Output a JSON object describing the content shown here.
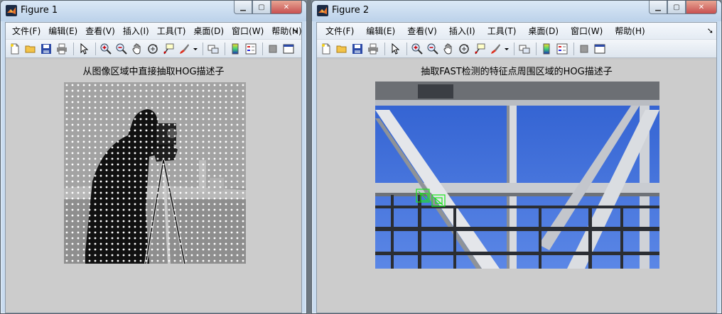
{
  "windows": [
    {
      "title": "Figure 1",
      "menu": [
        "文件(F)",
        "编辑(E)",
        "查看(V)",
        "插入(I)",
        "工具(T)",
        "桌面(D)",
        "窗口(W)",
        "帮助(H)"
      ],
      "figure_title": "从图像区域中直接抽取HOG描述子"
    },
    {
      "title": "Figure 2",
      "menu": [
        "文件(F)",
        "编辑(E)",
        "查看(V)",
        "插入(I)",
        "工具(T)",
        "桌面(D)",
        "窗口(W)",
        "帮助(H)"
      ],
      "figure_title": "抽取FAST检测的特征点周围区域的HOG描述子"
    }
  ],
  "toolbar_icons": [
    "new-figure-icon",
    "open-file-icon",
    "save-icon",
    "print-icon",
    "pointer-icon",
    "zoom-in-icon",
    "zoom-out-icon",
    "pan-hand-icon",
    "rotate-3d-icon",
    "data-cursor-icon",
    "brush-icon",
    "link-plot-icon",
    "colorbar-icon",
    "legend-icon",
    "hide-plot-tools-icon",
    "show-plot-tools-icon"
  ],
  "caption_buttons": [
    "minimize-icon",
    "maximize-icon",
    "close-icon"
  ],
  "colors": {
    "matlab_orange": "#e8732a",
    "figure_bg": "#cccccc",
    "sky_blue": "#3f6fd3",
    "feature_box_green": "#19e61c"
  }
}
